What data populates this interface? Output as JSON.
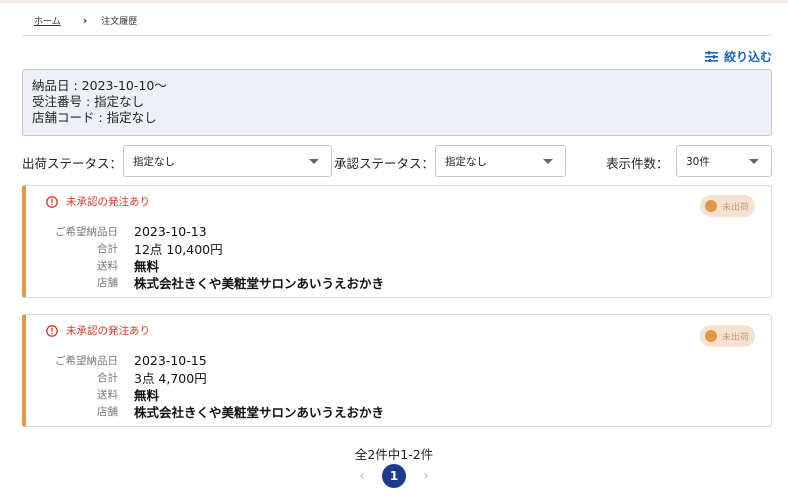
{
  "breadcrumb": {
    "home": "ホーム",
    "separator": "›",
    "current": "注文履歴"
  },
  "filter_link": {
    "label": "絞り込む",
    "icon": "filter-sliders-icon",
    "color": "#1e63b8"
  },
  "summary": [
    "納品日 : 2023-10-10〜",
    "受注番号 : 指定なし",
    "店舗コード : 指定なし"
  ],
  "controls": {
    "shipping_label": "出荷ステータス：",
    "shipping_value": "指定なし",
    "approval_label": "承認ステータス：",
    "approval_value": "指定なし",
    "count_label": "表示件数：",
    "count_value": "30件"
  },
  "orders": [
    {
      "alert": "未承認の発注あり",
      "status": "未出荷",
      "rows": [
        {
          "label": "ご希望納品日",
          "value": "2023-10-13"
        },
        {
          "label": "合計",
          "value": "12点 10,400円"
        },
        {
          "label": "送料",
          "value": "無料"
        },
        {
          "label": "店舗",
          "value": "株式会社きくや美粧堂サロンあいうえおかき"
        }
      ]
    },
    {
      "alert": "未承認の発注あり",
      "status": "未出荷",
      "rows": [
        {
          "label": "ご希望納品日",
          "value": "2023-10-15"
        },
        {
          "label": "合計",
          "value": "3点 4,700円"
        },
        {
          "label": "送料",
          "value": "無料"
        },
        {
          "label": "店舗",
          "value": "株式会社きくや美粧堂サロンあいうえおかき"
        }
      ]
    }
  ],
  "pagination": {
    "summary": "全2件中1-2件",
    "prev": "‹",
    "current": "1",
    "next": "›"
  },
  "colors": {
    "accent": "#e0974a",
    "alert": "#d33a2c",
    "pager_active": "#1d3b8c",
    "summary_bg": "#edf1f7"
  }
}
